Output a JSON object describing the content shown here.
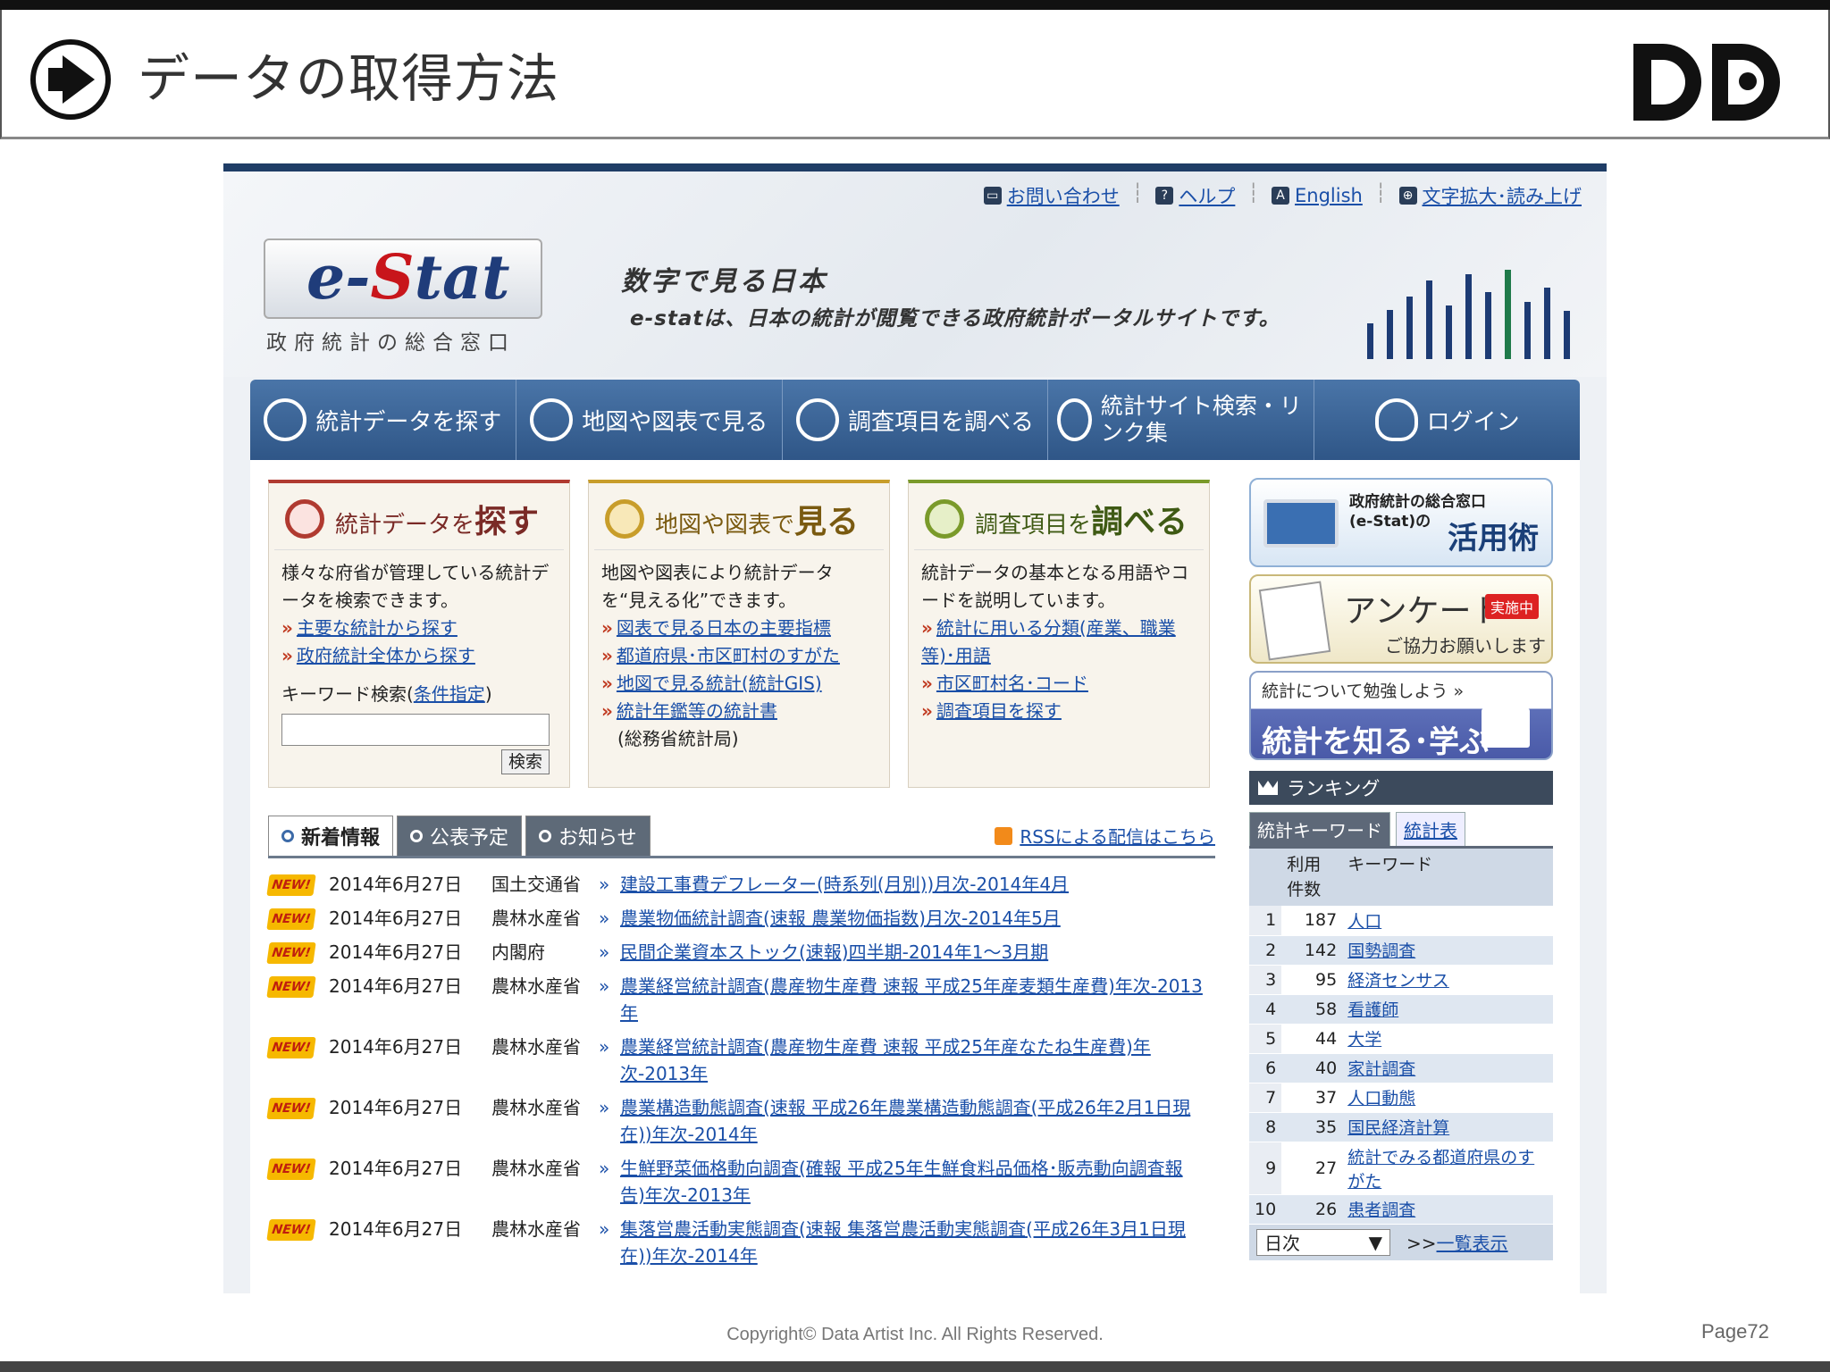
{
  "slide": {
    "title": "データの取得方法",
    "copyright": "Copyright© Data Artist Inc.  All Rights Reserved.",
    "page": "Page72"
  },
  "site": {
    "util_nav": [
      "お問い合わせ",
      "ヘルプ",
      "English",
      "文字拡大･読み上げ"
    ],
    "logo": "e-Stat",
    "logo_sub": "政府統計の総合窓口",
    "hero_title": "数字で見る日本",
    "hero_desc": "e-statは、日本の統計が閲覧できる政府統計ポータルサイトです。"
  },
  "main_nav": [
    "統計データを探す",
    "地図や図表で見る",
    "調査項目を調べる",
    "統計サイト検索・リンク集",
    "ログイン"
  ],
  "cards": [
    {
      "title_a": "統計データを",
      "title_b": "探す",
      "desc": "様々な府省が管理している統計データを検索できます。",
      "links": [
        "主要な統計から探す",
        "政府統計全体から探す"
      ],
      "kw_label": "キーワード検索(",
      "kw_link": "条件指定",
      "kw_close": ")",
      "search_btn": "検索"
    },
    {
      "title_a": "地図や図表で",
      "title_b": "見る",
      "desc": "地図や図表により統計データを“見える化”できます。",
      "links": [
        "図表で見る日本の主要指標",
        "都道府県･市区町村のすがた",
        "地図で見る統計(統計GIS)",
        "統計年鑑等の統計書"
      ],
      "note": "(総務省統計局)"
    },
    {
      "title_a": "調査項目を",
      "title_b": "調べる",
      "desc": "統計データの基本となる用語やコードを説明しています。",
      "links": [
        "統計に用いる分類(産業、職業等)･用語",
        "市区町村名･コード",
        "調査項目を探す"
      ]
    }
  ],
  "banners": {
    "b1_line1": "政府統計の総合窓口",
    "b1_line2": "(e-Stat)の",
    "b1_big": "活用術",
    "b2_title": "アンケート",
    "b2_tag": "実施中",
    "b2_sub": "ご協力お願いします",
    "b3_line1": "統計について勉強しよう »",
    "b3_line2": "統計を知る･学ぶ"
  },
  "ranking": {
    "title": "ランキング",
    "tabs": [
      "統計キーワード",
      "統計表"
    ],
    "col_count": "利用件数",
    "col_kw": "キーワード",
    "rows": [
      {
        "n": "1",
        "c": "187",
        "k": "人口"
      },
      {
        "n": "2",
        "c": "142",
        "k": "国勢調査"
      },
      {
        "n": "3",
        "c": "95",
        "k": "経済センサス"
      },
      {
        "n": "4",
        "c": "58",
        "k": "看護師"
      },
      {
        "n": "5",
        "c": "44",
        "k": "大学"
      },
      {
        "n": "6",
        "c": "40",
        "k": "家計調査"
      },
      {
        "n": "7",
        "c": "37",
        "k": "人口動態"
      },
      {
        "n": "8",
        "c": "35",
        "k": "国民経済計算"
      },
      {
        "n": "9",
        "c": "27",
        "k": "統計でみる都道府県のすがた"
      },
      {
        "n": "10",
        "c": "26",
        "k": "患者調査"
      }
    ],
    "period": "日次",
    "more_prefix": ">>",
    "more": "一覧表示"
  },
  "news_tabs": [
    "新着情報",
    "公表予定",
    "お知らせ"
  ],
  "rss": "RSSによる配信はこちら",
  "news_badge": "NEW!",
  "news": [
    {
      "date": "2014年6月27日",
      "org": "国土交通省",
      "title": "建設工事費デフレーター(時系列(月別))月次-2014年4月"
    },
    {
      "date": "2014年6月27日",
      "org": "農林水産省",
      "title": "農業物価統計調査(速報 農業物価指数)月次-2014年5月"
    },
    {
      "date": "2014年6月27日",
      "org": "内閣府",
      "title": "民間企業資本ストック(速報)四半期-2014年1～3月期"
    },
    {
      "date": "2014年6月27日",
      "org": "農林水産省",
      "title": "農業経営統計調査(農産物生産費 速報 平成25年産麦類生産費)年次-2013年"
    },
    {
      "date": "2014年6月27日",
      "org": "農林水産省",
      "title": "農業経営統計調査(農産物生産費 速報 平成25年産なたね生産費)年次-2013年"
    },
    {
      "date": "2014年6月27日",
      "org": "農林水産省",
      "title": "農業構造動態調査(速報 平成26年農業構造動態調査(平成26年2月1日現在))年次-2014年"
    },
    {
      "date": "2014年6月27日",
      "org": "農林水産省",
      "title": "生鮮野菜価格動向調査(確報 平成25年生鮮食料品価格･販売動向調査報告)年次-2013年"
    },
    {
      "date": "2014年6月27日",
      "org": "農林水産省",
      "title": "集落営農活動実態調査(速報 集落営農活動実態調査(平成26年3月1日現在))年次-2014年"
    }
  ]
}
